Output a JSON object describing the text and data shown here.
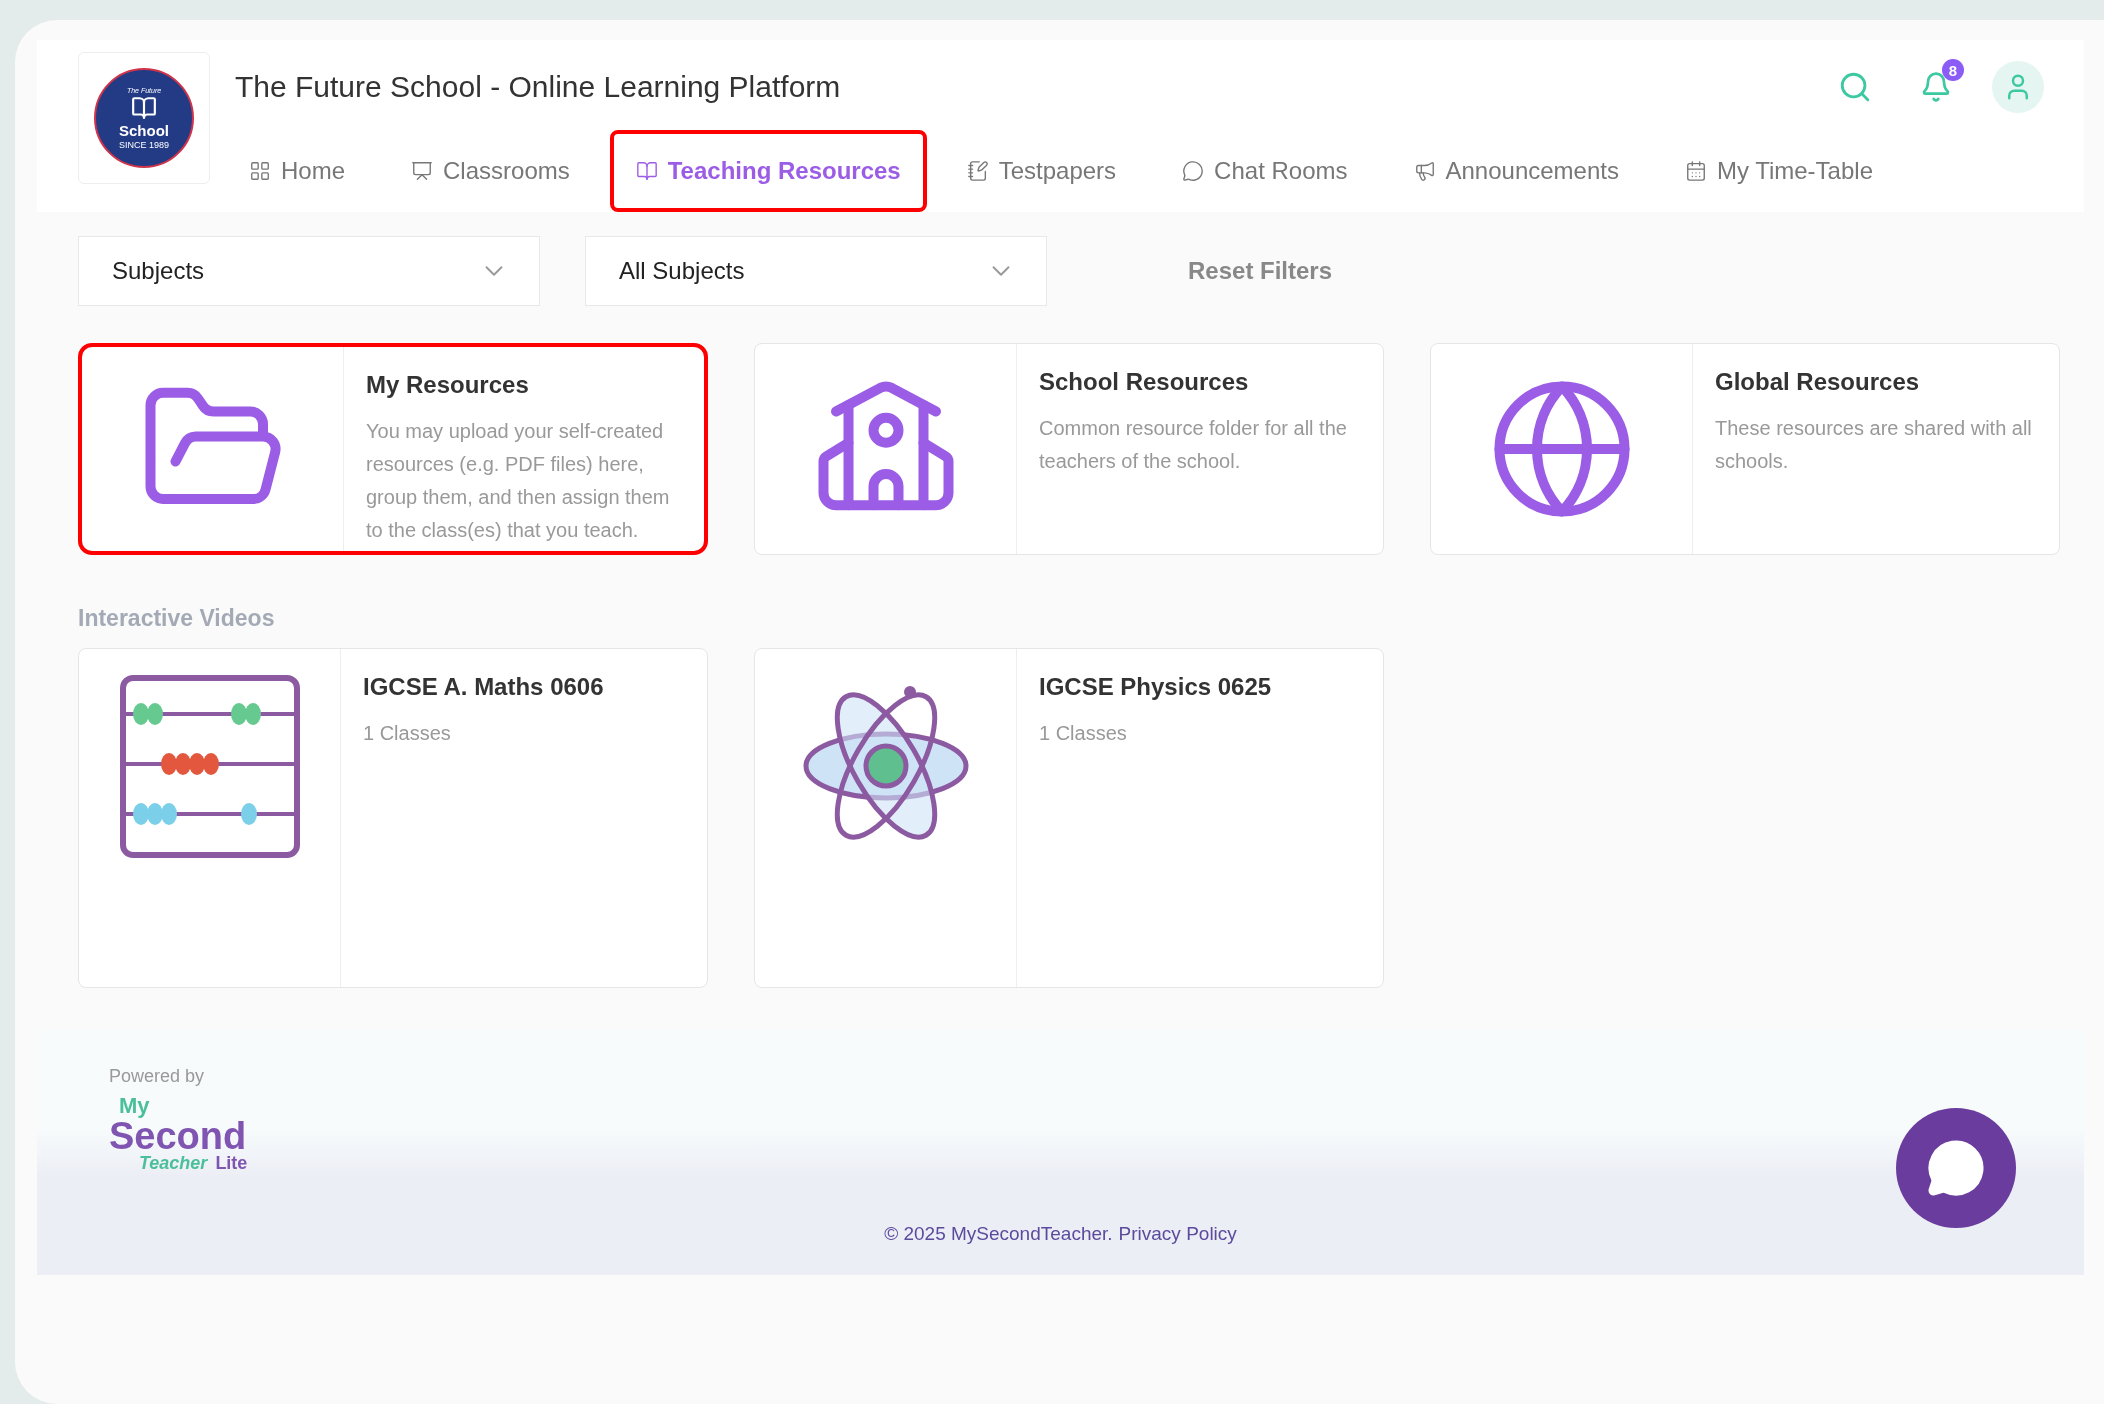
{
  "header": {
    "school_logo": {
      "top_text": "The Future",
      "name": "School",
      "since": "SINCE 1989"
    },
    "title": "The Future School - Online Learning Platform",
    "notification_count": "8"
  },
  "tabs": [
    {
      "label": "Home",
      "selected": false,
      "highlighted": false
    },
    {
      "label": "Classrooms",
      "selected": false,
      "highlighted": false
    },
    {
      "label": "Teaching Resources",
      "selected": true,
      "highlighted": true
    },
    {
      "label": "Testpapers",
      "selected": false,
      "highlighted": false
    },
    {
      "label": "Chat Rooms",
      "selected": false,
      "highlighted": false
    },
    {
      "label": "Announcements",
      "selected": false,
      "highlighted": false
    },
    {
      "label": "My Time-Table",
      "selected": false,
      "highlighted": false
    }
  ],
  "filters": [
    {
      "value": "Subjects"
    },
    {
      "value": "All Subjects"
    }
  ],
  "reset_button": "Reset Filters",
  "resource_cards": [
    {
      "kind": "folder",
      "title": "My Resources",
      "description": "You may upload your self-created resources (e.g. PDF files) here, group them, and then assign them to the class(es) that you teach.",
      "highlighted": true
    },
    {
      "kind": "school",
      "title": "School Resources",
      "description": "Common resource folder for all the teachers of the school.",
      "highlighted": false
    },
    {
      "kind": "globe",
      "title": "Global Resources",
      "description": "These resources are shared with all schools.",
      "highlighted": false
    }
  ],
  "section_title": "Interactive Videos",
  "videos": [
    {
      "kind": "abacus",
      "title": "IGCSE A. Maths 0606",
      "classes": "1 Classes"
    },
    {
      "kind": "atom",
      "title": "IGCSE Physics 0625",
      "classes": "1 Classes"
    }
  ],
  "footer": {
    "powered_by": "Powered by",
    "brand": {
      "my": "My",
      "second": "Second",
      "teacher": "Teacher",
      "lite": "Lite"
    },
    "copyright": "© 2025 MySecondTeacher.",
    "privacy_link": "Privacy Policy"
  }
}
